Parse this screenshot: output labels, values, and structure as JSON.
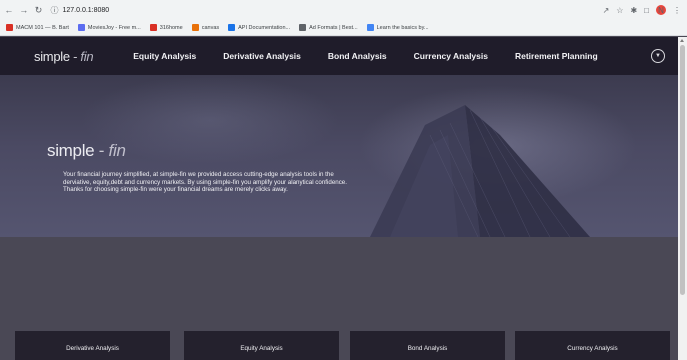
{
  "browser": {
    "url": "127.0.0.1:8080",
    "bookmarks": [
      {
        "label": "MACM 101 — B. Bart",
        "color": "#d93025"
      },
      {
        "label": "MoviesJoy - Free m...",
        "color": "#5b6cf0"
      },
      {
        "label": "316home",
        "color": "#d93025"
      },
      {
        "label": "canvas",
        "color": "#e8710a"
      },
      {
        "label": "API Documentation...",
        "color": "#1a73e8"
      },
      {
        "label": "Ad Formats | Best...",
        "color": "#5f6368"
      },
      {
        "label": "Learn the basics by...",
        "color": "#4285f4"
      }
    ],
    "profile_initial": "N"
  },
  "site": {
    "brand": {
      "part1": "simple",
      "dash": " - ",
      "part2": "fin"
    },
    "nav": [
      "Equity Analysis",
      "Derivative Analysis",
      "Bond Analysis",
      "Currency Analysis",
      "Retirement Planning"
    ],
    "hero": {
      "title1": "simple",
      "dash": " - ",
      "title2": "fin",
      "text": "Your financial journey simplified, at simple-fin we provided access cutting-edge analysis tools in the derviative, equity,debt and currency markets. By using simple-fin you amplify your alanytical confidence. Thanks for choosing simple-fin were your financial dreams are merely clicks away."
    },
    "cards": [
      "Derivative Analysis",
      "Equity Analysis",
      "Bond Analysis",
      "Currency Analysis"
    ]
  },
  "colors": {
    "nav_bg": "#1f1c2a",
    "page_bg": "#4a4854",
    "card_bg": "#24212d"
  }
}
